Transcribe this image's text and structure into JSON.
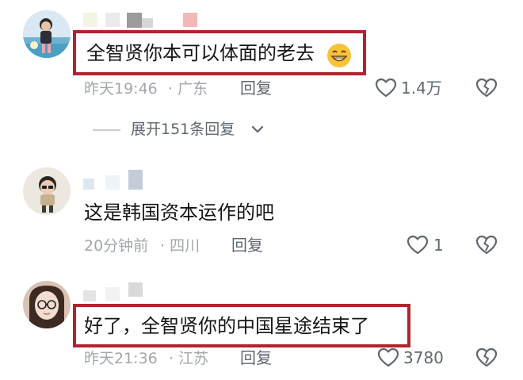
{
  "comments": [
    {
      "text": "全智贤你本可以体面的老去",
      "time": "昨天19:46",
      "location": "· 广东",
      "reply_label": "回复",
      "likes": "1.4万",
      "highlighted": true,
      "has_emoji": true,
      "expand_replies": "展开151条回复"
    },
    {
      "text": "这是韩国资本运作的吧",
      "time": "20分钟前",
      "location": "· 四川",
      "reply_label": "回复",
      "likes": "1",
      "highlighted": false
    },
    {
      "text": "好了，全智贤你的中国星途结束了",
      "time": "昨天21:36",
      "location": "· 江苏",
      "reply_label": "回复",
      "likes": "3780",
      "highlighted": true
    }
  ],
  "colors": {
    "highlight_border": "#b3232d",
    "meta_text": "#a3a7ad",
    "action_text": "#5f6770"
  },
  "icons": {
    "like": "heart-outline-icon",
    "dislike": "broken-heart-icon",
    "expand": "chevron-down-icon",
    "emoji": "grinning-face-emoji"
  }
}
